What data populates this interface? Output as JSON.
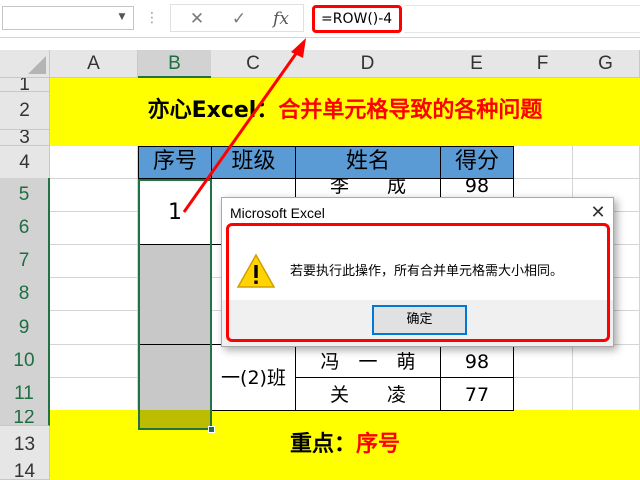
{
  "formula_bar": {
    "name_box_value": "",
    "cancel_icon": "✕",
    "enter_icon": "✓",
    "fx_label": "fx",
    "formula": "=ROW()-4"
  },
  "columns": [
    "A",
    "B",
    "C",
    "D",
    "E",
    "F",
    "G"
  ],
  "rows": [
    "1",
    "2",
    "3",
    "4",
    "5",
    "6",
    "7",
    "8",
    "9",
    "10",
    "11",
    "12",
    "13",
    "14"
  ],
  "title": {
    "black": "亦心Excel：",
    "red": "合并单元格导致的各种问题"
  },
  "table": {
    "headers": [
      "序号",
      "班级",
      "姓名",
      "得分"
    ],
    "b5_value": "1",
    "class_label": "一(2)班",
    "names": [
      "李　　成",
      "冯　一　萌",
      "关　　凌"
    ],
    "scores": [
      "98",
      "98",
      "77"
    ]
  },
  "focus": {
    "black": "重点：",
    "red": "序号"
  },
  "dialog": {
    "title": "Microsoft Excel",
    "close_icon": "✕",
    "message": "若要执行此操作，所有合并单元格需大小相同。",
    "ok_label": "确定"
  },
  "colors": {
    "yellow": "#ffff00",
    "header_blue": "#5b9bd5",
    "highlight_red": "#ff0000",
    "excel_green": "#217346"
  }
}
